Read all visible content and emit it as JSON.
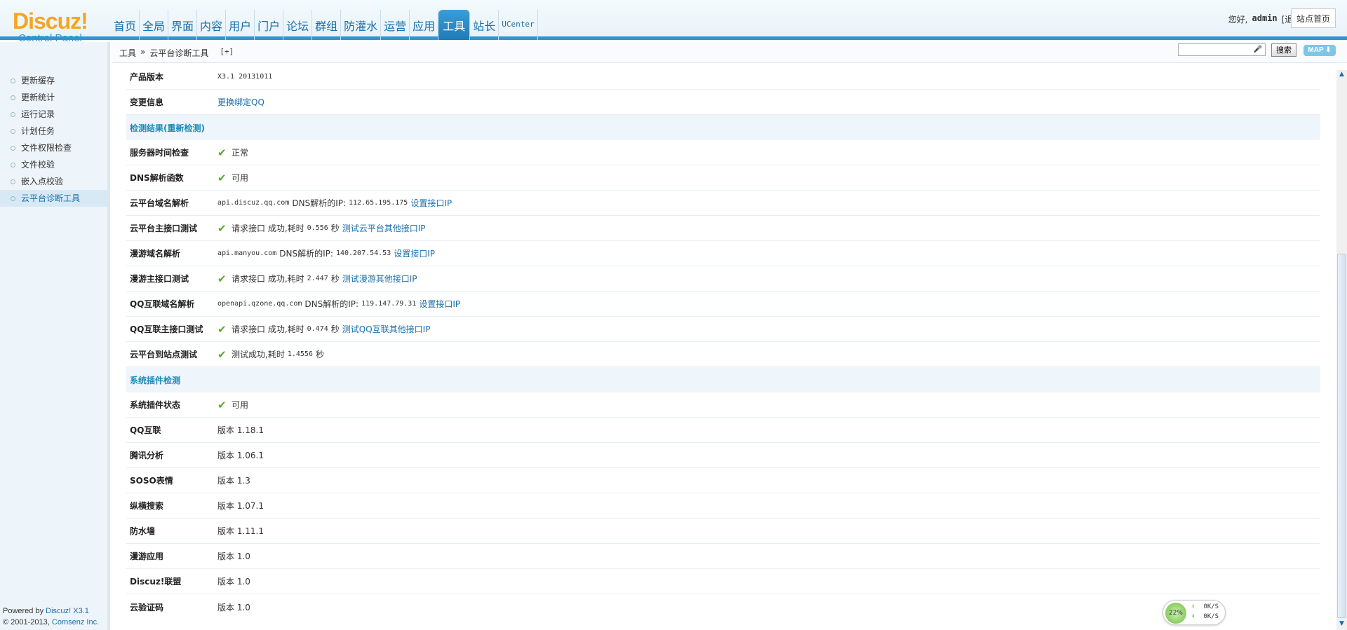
{
  "logo": {
    "main": "Discuz",
    "exclaim": "!",
    "sub": "Control Panel"
  },
  "nav": [
    {
      "label": "首页"
    },
    {
      "label": "全局"
    },
    {
      "label": "界面"
    },
    {
      "label": "内容"
    },
    {
      "label": "用户"
    },
    {
      "label": "门户"
    },
    {
      "label": "论坛"
    },
    {
      "label": "群组"
    },
    {
      "label": "防灌水"
    },
    {
      "label": "运营"
    },
    {
      "label": "应用"
    },
    {
      "label": "工具",
      "active": true
    },
    {
      "label": "站长"
    },
    {
      "label": "UCenter"
    }
  ],
  "user": {
    "greeting": "您好,",
    "name": "admin",
    "logout": "[退出]",
    "site_home": "站点首页"
  },
  "breadcrumb": {
    "parent": "工具",
    "sep": "»",
    "current": "云平台诊断工具",
    "plus": "[+]"
  },
  "search": {
    "button": "搜索",
    "map": "MAP ⬇"
  },
  "sidebar": {
    "items": [
      {
        "label": "更新缓存"
      },
      {
        "label": "更新统计"
      },
      {
        "label": "运行记录"
      },
      {
        "label": "计划任务"
      },
      {
        "label": "文件权限检查"
      },
      {
        "label": "文件校验"
      },
      {
        "label": "嵌入点校验"
      },
      {
        "label": "云平台诊断工具",
        "active": true
      }
    ],
    "footer_line1_prefix": "Powered by ",
    "footer_line1_brand": "Discuz! X3.1",
    "footer_line2_prefix": "© 2001-2013, ",
    "footer_line2_brand": "Comsenz Inc."
  },
  "rows": {
    "product_version": {
      "key": "产品版本",
      "value": "X3.1 20131011"
    },
    "change_info": {
      "key": "变更信息",
      "link": "更换绑定QQ"
    },
    "section_detect": {
      "title": "检测结果",
      "action": "(重新检测)"
    },
    "server_time": {
      "key": "服务器时间检查",
      "value": "正常"
    },
    "dns_func": {
      "key": "DNS解析函数",
      "value": "可用"
    },
    "cloud_domain": {
      "key": "云平台域名解析",
      "host": "api.discuz.qq.com",
      "label": "DNS解析的IP:",
      "ip": "112.65.195.175",
      "link": "设置接口IP"
    },
    "cloud_api": {
      "key": "云平台主接口测试",
      "text": "请求接口 成功,耗时",
      "time": "0.556",
      "unit": "秒",
      "link": "测试云平台其他接口IP"
    },
    "manyou_domain": {
      "key": "漫游域名解析",
      "host": "api.manyou.com",
      "label": "DNS解析的IP:",
      "ip": "140.207.54.53",
      "link": "设置接口IP"
    },
    "manyou_api": {
      "key": "漫游主接口测试",
      "text": "请求接口 成功,耗时",
      "time": "2.447",
      "unit": "秒",
      "link": "测试漫游其他接口IP"
    },
    "qq_domain": {
      "key": "QQ互联域名解析",
      "host": "openapi.qzone.qq.com",
      "label": "DNS解析的IP:",
      "ip": "119.147.79.31",
      "link": "设置接口IP"
    },
    "qq_api": {
      "key": "QQ互联主接口测试",
      "text": "请求接口 成功,耗时",
      "time": "0.474",
      "unit": "秒",
      "link": "测试QQ互联其他接口IP"
    },
    "cloud_site": {
      "key": "云平台到站点测试",
      "text": "测试成功,耗时",
      "time": "1.4556",
      "unit": "秒"
    },
    "section_plugin": {
      "title": "系统插件检测"
    },
    "plugin_status": {
      "key": "系统插件状态",
      "value": "可用"
    },
    "plugins": [
      {
        "key": "QQ互联",
        "value": "版本 1.18.1"
      },
      {
        "key": "腾讯分析",
        "value": "版本 1.06.1"
      },
      {
        "key": "SOSO表情",
        "value": "版本 1.3"
      },
      {
        "key": "纵横搜索",
        "value": "版本 1.07.1"
      },
      {
        "key": "防水墙",
        "value": "版本 1.11.1"
      },
      {
        "key": "漫游应用",
        "value": "版本 1.0"
      },
      {
        "key": "Discuz!联盟",
        "value": "版本 1.0"
      },
      {
        "key": "云验证码",
        "value": "版本 1.0"
      }
    ]
  },
  "speed_widget": {
    "percent": "22%",
    "up": "0K/S",
    "down": "0K/S"
  },
  "colors": {
    "accent": "#2f95d1",
    "link": "#1a6faa",
    "check": "#5aa628",
    "logo": "#f7a421"
  }
}
